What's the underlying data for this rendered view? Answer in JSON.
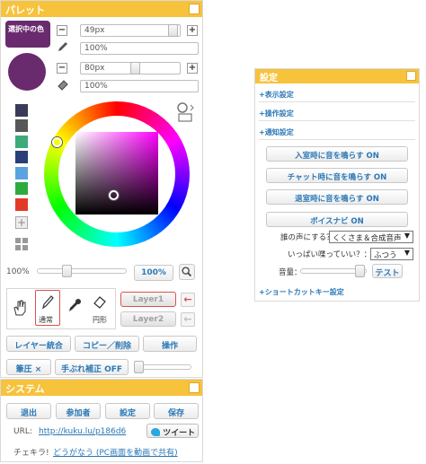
{
  "palette": {
    "title": "パレット",
    "selected_color_label": "選択中の色",
    "current_color": "#6a2a6e",
    "brush_size": "49px",
    "brush_opacity": "100%",
    "eraser_size": "80px",
    "eraser_opacity": "100%",
    "minus": "−",
    "plus": "+",
    "swatches": [
      "#3a3a5a",
      "#585858",
      "#3daa7a",
      "#2b3e78",
      "#5aa3e0",
      "#2eaa3e",
      "#e23a2a"
    ],
    "zoom_value": "100%",
    "zoom_button": "100%",
    "tools": {
      "normal_label": "通常",
      "circle_label": "円形"
    },
    "layer1": "Layer1",
    "layer2": "Layer2",
    "arrow": "←",
    "merge_layers": "レイヤー統合",
    "copy_delete": "コピー／削除",
    "operation": "操作",
    "pressure": "筆圧 ×",
    "stabilizer": "手ぶれ補正 OFF"
  },
  "system": {
    "title": "システム",
    "exit": "退出",
    "participants": "参加者",
    "settings": "設定",
    "save": "保存",
    "url_label": "URL:",
    "url": "http://kuku.lu/p186d6",
    "tweet": "ツイート",
    "chekira_label": "チェキラ!",
    "chekira_link": "どうがなう (PC画面を動画で共有)"
  },
  "settings": {
    "title": "設定",
    "display": "+表示設定",
    "operation": "+操作設定",
    "notification": "+通知設定",
    "enter_sound": "入室時に音を鳴らす ON",
    "chat_sound": "チャット時に音を鳴らす ON",
    "leave_sound": "退室時に音を鳴らす ON",
    "voice_navi": "ボイスナビ ON",
    "voice_question": "誰の声にする？：",
    "voice_value": "くくさま＆合成音声",
    "talk_question": "いっぱい喋っていい？：",
    "talk_value": "ふつう",
    "volume_label": "音量：",
    "test_button": "テスト",
    "shortcut": "+ショートカットキー設定",
    "select_arrow": "▼"
  }
}
